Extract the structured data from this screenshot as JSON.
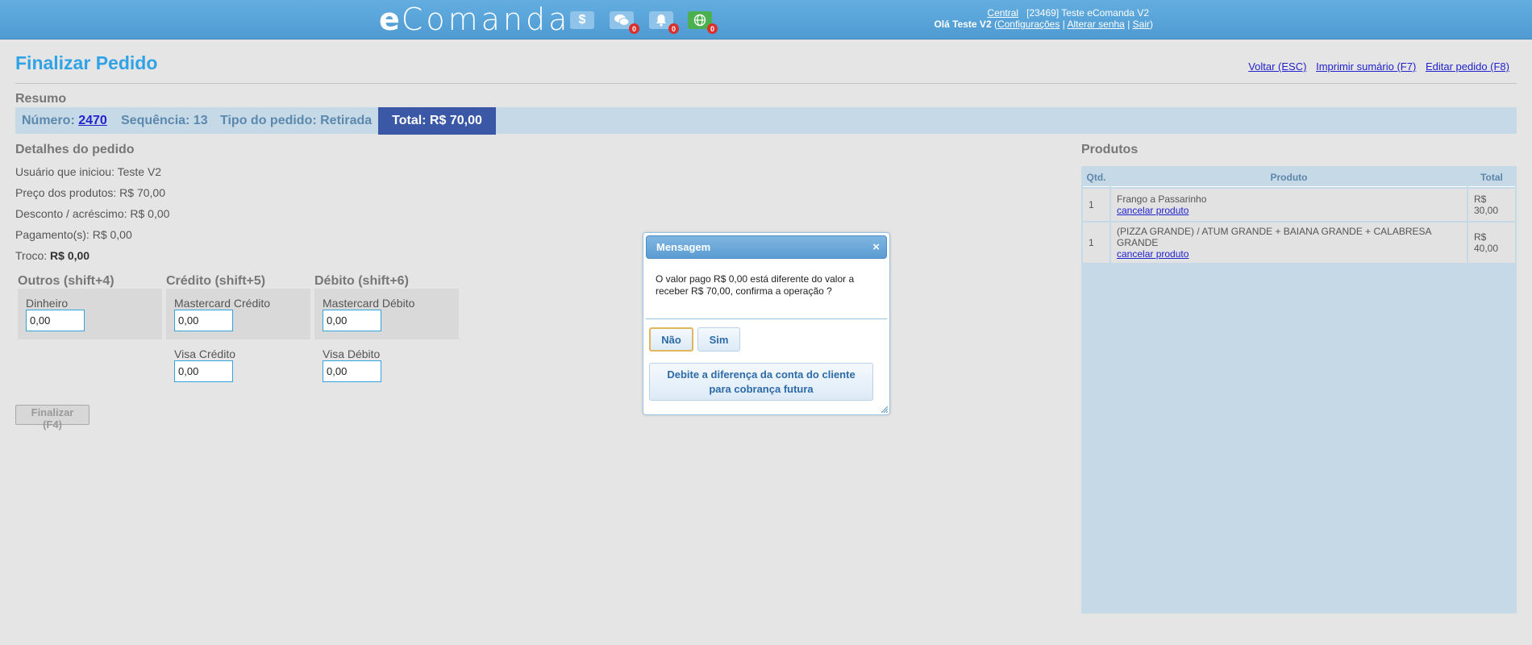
{
  "app": {
    "logo_first": "e",
    "logo_rest": "Comanda",
    "badges": {
      "chat": "0",
      "notifications": "0",
      "online": "0"
    },
    "user": {
      "central_link": "Central",
      "company": "[23469] Teste eComanda V2",
      "greeting": "Olá Teste V2",
      "config_link": "Configurações",
      "password_link": "Alterar senha",
      "logout_link": "Sair"
    }
  },
  "page": {
    "title": "Finalizar Pedido",
    "links": {
      "back": "Voltar (ESC)",
      "print": "Imprimir sumário (F7)",
      "edit": "Editar pedido (F8)"
    }
  },
  "summary": {
    "heading": "Resumo",
    "number_label": "Número:",
    "number_value": "2470",
    "sequence": "Sequência: 13",
    "order_type": "Tipo do pedido: Retirada",
    "total": "Total: R$ 70,00"
  },
  "details": {
    "heading": "Detalhes do pedido",
    "user": "Usuário que iniciou: Teste V2",
    "products_price": "Preço dos produtos: R$ 70,00",
    "discount": "Desconto / acréscimo: R$ 0,00",
    "payments": "Pagamento(s): R$ 0,00",
    "change_label": "Troco:",
    "change_value": "R$ 0,00"
  },
  "payments": {
    "others": {
      "title": "Outros (shift+4)",
      "methods": [
        {
          "label": "Dinheiro",
          "value": "0,00"
        }
      ]
    },
    "credit": {
      "title": "Crédito (shift+5)",
      "methods": [
        {
          "label": "Mastercard Crédito",
          "value": "0,00"
        },
        {
          "label": "Visa Crédito",
          "value": "0,00"
        }
      ]
    },
    "debit": {
      "title": "Débito (shift+6)",
      "methods": [
        {
          "label": "Mastercard Débito",
          "value": "0,00"
        },
        {
          "label": "Visa Débito",
          "value": "0,00"
        }
      ]
    },
    "finalize_button": "Finalizar (F4)"
  },
  "products": {
    "heading": "Produtos",
    "columns": {
      "qty": "Qtd.",
      "product": "Produto",
      "total": "Total"
    },
    "rows": [
      {
        "qty": "1",
        "name": "Frango a Passarinho",
        "cancel": "cancelar produto",
        "total_currency": "R$",
        "total_value": "30,00"
      },
      {
        "qty": "1",
        "name": "(PIZZA GRANDE) / ATUM GRANDE + BAIANA GRANDE + CALABRESA GRANDE",
        "cancel": "cancelar produto",
        "total_currency": "R$",
        "total_value": "40,00"
      }
    ]
  },
  "dialog": {
    "title": "Mensagem",
    "close": "×",
    "message": "O valor pago R$ 0,00 está diferente do valor a receber R$ 70,00, confirma a operação ?",
    "no_button": "Não",
    "yes_button": "Sim",
    "debit_button": "Debite a diferença da conta do cliente para cobrança futura"
  },
  "colors": {
    "topbar": "#5aa5dc",
    "title": "#2fa3e6",
    "summary_bar": "#c6d9e6",
    "total_bg": "#3a58a6",
    "input_border": "#33a3dc",
    "badge": "#d9302c"
  },
  "icons": {
    "topbar": [
      "dollar-icon",
      "chat-icon",
      "bell-icon",
      "globe-icon"
    ],
    "dialog": [
      "close-icon",
      "resize-grip-icon"
    ]
  }
}
